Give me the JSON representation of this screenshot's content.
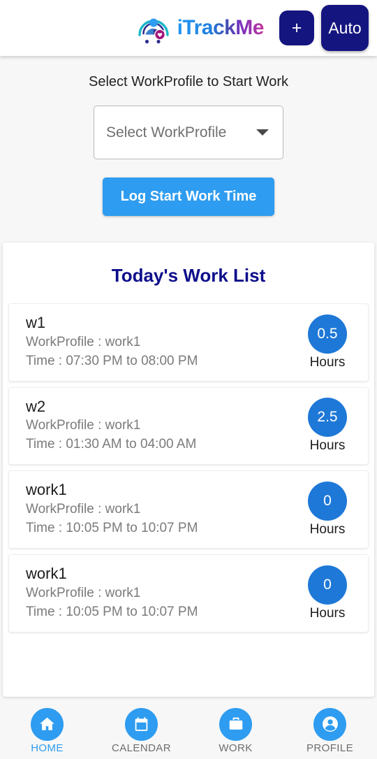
{
  "header": {
    "brand_name": "iTrackMe",
    "logo_icon": "itrackme-person-heart-logo",
    "add_button_label": "+",
    "auto_button_label": "Auto",
    "button_color": "#15157f"
  },
  "select_panel": {
    "label": "Select WorkProfile to Start Work",
    "dropdown_value": "Select WorkProfile",
    "dropdown_placeholder": "Select WorkProfile",
    "dropdown_icon": "chevron-down-icon",
    "log_button_label": "Log Start Work Time",
    "log_button_color": "#2e9cf0"
  },
  "work_list": {
    "title": "Today's Work List",
    "title_color": "#0e0e8c",
    "hours_unit_label": "Hours",
    "badge_color": "#1e78d7",
    "items": [
      {
        "name": "w1",
        "profile": "WorkProfile : work1",
        "time": "Time : 07:30 PM to 08:00 PM",
        "hours": "0.5",
        "hours_label": "Hours"
      },
      {
        "name": "w2",
        "profile": "WorkProfile : work1",
        "time": "Time : 01:30 AM to 04:00 AM",
        "hours": "2.5",
        "hours_label": "Hours"
      },
      {
        "name": "work1",
        "profile": "WorkProfile : work1",
        "time": "Time : 10:05 PM to 10:07 PM",
        "hours": "0",
        "hours_label": "Hours"
      },
      {
        "name": "work1",
        "profile": "WorkProfile : work1",
        "time": "Time : 10:05 PM to 10:07 PM",
        "hours": "0",
        "hours_label": "Hours"
      }
    ]
  },
  "bottom_nav": {
    "active_color": "#2e9cf0",
    "inactive_color": "#6d6d6d",
    "items": [
      {
        "label": "HOME",
        "icon": "home-icon",
        "active": true
      },
      {
        "label": "CALENDAR",
        "icon": "calendar-icon",
        "active": false
      },
      {
        "label": "WORK",
        "icon": "briefcase-icon",
        "active": false
      },
      {
        "label": "PROFILE",
        "icon": "person-icon",
        "active": false
      }
    ]
  }
}
